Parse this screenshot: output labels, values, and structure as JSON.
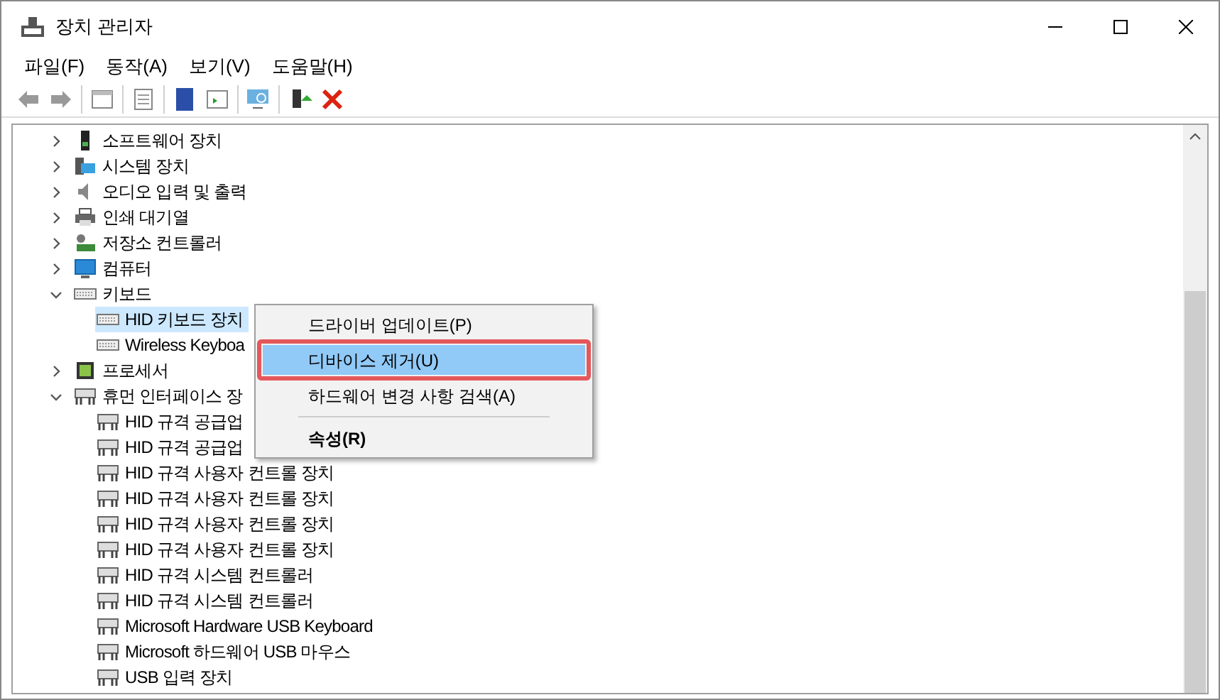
{
  "window": {
    "title": "장치 관리자"
  },
  "menu_bar": [
    "파일(F)",
    "동작(A)",
    "보기(V)",
    "도움말(H)"
  ],
  "tree": [
    {
      "label": "소프트웨어 장치",
      "kind": "software",
      "expanded": false,
      "selected": false
    },
    {
      "label": "시스템 장치",
      "kind": "system",
      "expanded": false,
      "selected": false
    },
    {
      "label": "오디오 입력 및 출력",
      "kind": "audio",
      "expanded": false,
      "selected": false
    },
    {
      "label": "인쇄 대기열",
      "kind": "printer",
      "expanded": false,
      "selected": false
    },
    {
      "label": "저장소 컨트롤러",
      "kind": "storage",
      "expanded": false,
      "selected": false
    },
    {
      "label": "컴퓨터",
      "kind": "computer",
      "expanded": false,
      "selected": false
    },
    {
      "label": "키보드",
      "kind": "keyboard",
      "expanded": true,
      "selected": false,
      "children": [
        {
          "label": "HID 키보드 장치",
          "kind": "keyboard",
          "selected": true
        },
        {
          "label": "Wireless Keyboa",
          "kind": "keyboard",
          "selected": false
        }
      ]
    },
    {
      "label": "프로세서",
      "kind": "processor",
      "expanded": false,
      "selected": false
    },
    {
      "label": "휴먼 인터페이스 장",
      "kind": "hid",
      "expanded": true,
      "selected": false,
      "children": [
        {
          "label": "HID 규격 공급업",
          "kind": "hid",
          "selected": false
        },
        {
          "label": "HID 규격 공급업",
          "kind": "hid",
          "selected": false
        },
        {
          "label": "HID 규격 사용자 컨트롤 장치",
          "kind": "hid",
          "selected": false
        },
        {
          "label": "HID 규격 사용자 컨트롤 장치",
          "kind": "hid",
          "selected": false
        },
        {
          "label": "HID 규격 사용자 컨트롤 장치",
          "kind": "hid",
          "selected": false
        },
        {
          "label": "HID 규격 사용자 컨트롤 장치",
          "kind": "hid",
          "selected": false
        },
        {
          "label": "HID 규격 시스템 컨트롤러",
          "kind": "hid",
          "selected": false
        },
        {
          "label": "HID 규격 시스템 컨트롤러",
          "kind": "hid",
          "selected": false
        },
        {
          "label": "Microsoft Hardware USB Keyboard",
          "kind": "hid",
          "selected": false
        },
        {
          "label": "Microsoft 하드웨어 USB 마우스",
          "kind": "hid",
          "selected": false
        },
        {
          "label": "USB 입력 장치",
          "kind": "hid",
          "selected": false
        }
      ]
    }
  ],
  "context_menu": [
    {
      "kind": "item",
      "label": "드라이버 업데이트(P)",
      "selected": false,
      "default": false,
      "outlined": false
    },
    {
      "kind": "item",
      "label": "디바이스 제거(U)",
      "selected": true,
      "default": false,
      "outlined": true
    },
    {
      "kind": "item",
      "label": "하드웨어 변경 사항 검색(A)",
      "selected": false,
      "default": false,
      "outlined": false
    },
    {
      "kind": "separator"
    },
    {
      "kind": "item",
      "label": "속성(R)",
      "selected": false,
      "default": true,
      "outlined": false
    }
  ]
}
